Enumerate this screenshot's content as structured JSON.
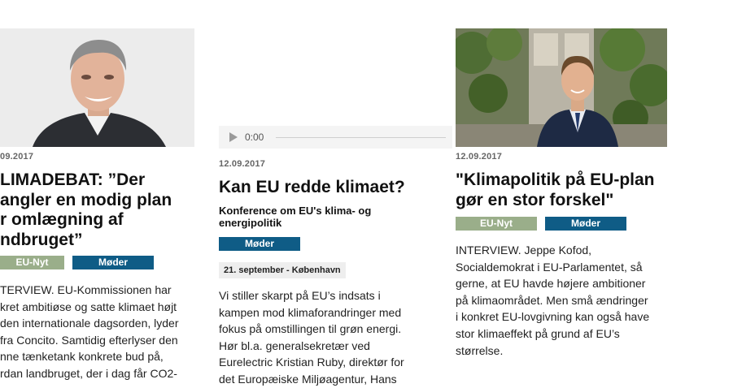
{
  "articles": [
    {
      "date": "09.2017",
      "headline_lines": [
        "LIMADEBAT: ”Der",
        "angler en modig plan",
        "r omlægning af",
        "ndbruget”"
      ],
      "tags": [
        "EU-Nyt",
        "Møder"
      ],
      "body_lines": [
        "TERVIEW. EU-Kommissionen har",
        "kret ambitiøse og satte klimaet højt",
        "den internationale dagsorden, lyder",
        "fra Concito. Samtidig efterlyser den",
        "nne tænketank konkrete bud på,",
        "rdan landbruget, der i dag får CO2-"
      ]
    },
    {
      "player_time": "0:00",
      "date": "12.09.2017",
      "headline": "Kan EU redde klimaet?",
      "subheadline_lines": [
        "Konference om EU's klima- og",
        "energipolitik"
      ],
      "tags": [
        "Møder"
      ],
      "event": "21. september - København",
      "body_lines": [
        "Vi stiller skarpt på EU’s indsats i",
        "kampen mod klimaforandringer med",
        "fokus på omstillingen til grøn energi.",
        "Hør bl.a. generalsekretær ved",
        "Eurelectric Kristian Ruby, direktør for",
        "det Europæiske Miljøagentur, Hans"
      ]
    },
    {
      "date": "12.09.2017",
      "headline_lines": [
        "\"Klimapolitik på EU-plan",
        "gør en stor forskel\""
      ],
      "tags": [
        "EU-Nyt",
        "Møder"
      ],
      "body_lines": [
        "INTERVIEW. Jeppe Kofod,",
        "Socialdemokrat i EU-Parlamentet, så",
        "gerne, at EU havde højere ambitioner",
        "på klimaområdet. Men små ændringer",
        "i konkret EU-lovgivning kan også have",
        "stor klimaeffekt på grund af EU’s",
        "størrelse."
      ]
    }
  ]
}
